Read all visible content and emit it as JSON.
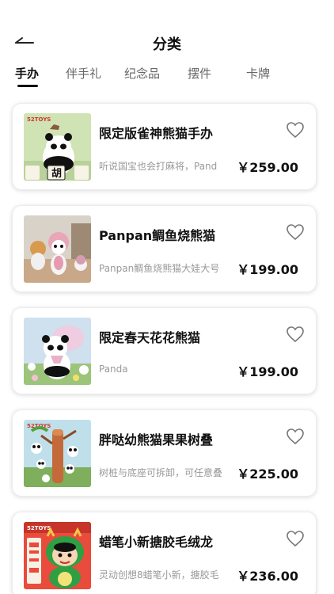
{
  "header": {
    "title": "分类"
  },
  "tabs": [
    {
      "label": "手办",
      "active": true
    },
    {
      "label": "伴手礼",
      "active": false
    },
    {
      "label": "纪念品",
      "active": false
    },
    {
      "label": "摆件",
      "active": false
    },
    {
      "label": "卡牌",
      "active": false
    }
  ],
  "products": [
    {
      "title": "限定版雀神熊猫手办",
      "desc": "听说国宝也会打麻将，Pand",
      "price": "￥259.00",
      "icon": "heart-outline-icon"
    },
    {
      "title": "Panpan鲷鱼烧熊猫",
      "desc": "Panpan鲷鱼烧熊猫大娃大号",
      "price": "￥199.00",
      "icon": "heart-outline-icon"
    },
    {
      "title": "限定春天花花熊猫",
      "desc": "Panda",
      "price": "￥199.00",
      "icon": "heart-outline-icon"
    },
    {
      "title": "胖哒幼熊猫果果树叠",
      "desc": "树桩与底座可拆卸，可任意叠",
      "price": "￥225.00",
      "icon": "heart-outline-icon"
    },
    {
      "title": "蜡笔小新搪胶毛绒龙",
      "desc": "灵动创想8蜡笔小新，搪胶毛",
      "price": "￥236.00",
      "icon": "heart-outline-icon"
    }
  ],
  "thumb_text": {
    "brand": "52TOYS",
    "tile": "胡"
  },
  "colors": {
    "text": "#111111",
    "muted": "#999999",
    "tab_inactive": "#666666"
  }
}
